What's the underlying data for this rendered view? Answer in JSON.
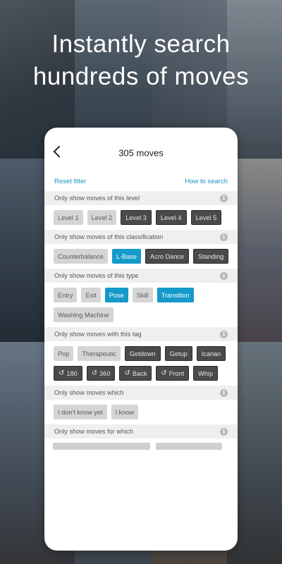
{
  "headline": {
    "line1": "Instantly search",
    "line2": "hundreds of moves"
  },
  "screen": {
    "title": "305 moves",
    "reset_filter": "Reset filter",
    "how_to_search": "How to search"
  },
  "sections": {
    "level": {
      "heading": "Only show moves of this level",
      "chips": [
        "Level 1",
        "Level 2",
        "Level 3",
        "Level 4",
        "Level 5"
      ]
    },
    "classification": {
      "heading": "Only show moves of this classification",
      "chips": [
        "Counterbalance",
        "L-Base",
        "Acro Dance",
        "Standing"
      ]
    },
    "type": {
      "heading": "Only show moves of this type",
      "chips": [
        "Entry",
        "Exit",
        "Pose",
        "Skill",
        "Transition",
        "Washing Machine"
      ]
    },
    "tag": {
      "heading": "Only show moves with this tag",
      "chips": [
        "Pop",
        "Therapeutic",
        "Getdown",
        "Getup",
        "Icarian",
        "180",
        "360",
        "Back",
        "Front",
        "Whip"
      ]
    },
    "which": {
      "heading": "Only show moves which",
      "chips": [
        "I don't know yet",
        "I know"
      ]
    },
    "for_which": {
      "heading": "Only show moves for which"
    }
  },
  "icons": {
    "back": "chevron-left-icon",
    "info": "info-icon",
    "rotate": "rotate-left-icon"
  },
  "colors": {
    "accent": "#1499c9",
    "link": "#1a8fc2",
    "dark_chip": "#4a4a4a",
    "light_chip": "#d5d5d5"
  }
}
